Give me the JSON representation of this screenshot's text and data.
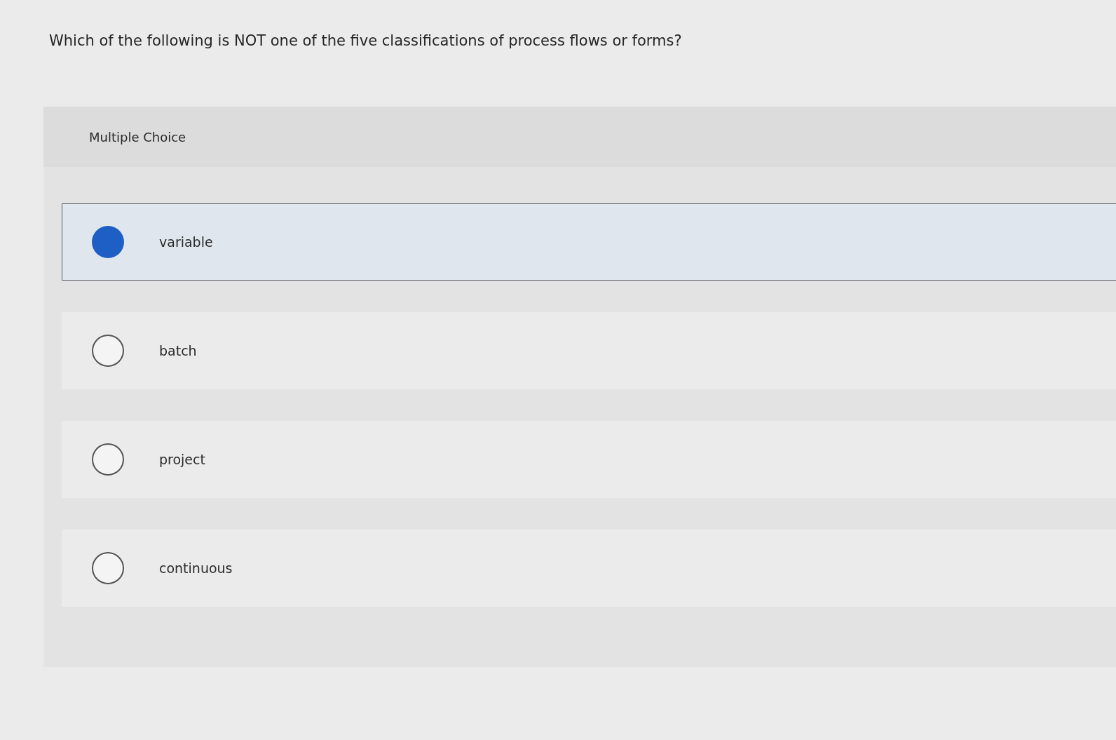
{
  "question": {
    "text": "Which of the following is NOT one of the five classifications of process flows or forms?"
  },
  "answer_panel": {
    "header": "Multiple Choice",
    "options": [
      {
        "label": "variable",
        "selected": true
      },
      {
        "label": "batch",
        "selected": false
      },
      {
        "label": "project",
        "selected": false
      },
      {
        "label": "continuous",
        "selected": false
      }
    ]
  }
}
